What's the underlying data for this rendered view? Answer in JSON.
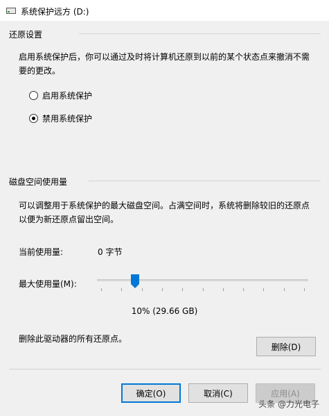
{
  "window": {
    "title": "系统保护远方 (D:)"
  },
  "restore_section": {
    "title": "还原设置",
    "description_line1": "启用系统保护后，你可以通过及时将计算机还原到以前的某个状态点来撤消不需",
    "description_line2": "要的更改。",
    "options": [
      {
        "label": "启用系统保护",
        "selected": false
      },
      {
        "label": "禁用系统保护",
        "selected": true
      }
    ]
  },
  "disk_section": {
    "title": "磁盘空间使用量",
    "description_line1": "可以调整用于系统保护的最大磁盘空间。占满空间时，系统将删除较旧的还原点",
    "description_line2": "以便为新还原点留出空间。",
    "current_usage_label": "当前使用量:",
    "current_usage_value": "0 字节",
    "max_usage_label": "最大使用量(M):",
    "slider_fraction": 0.1,
    "max_usage_value": "10% (29.66 GB)",
    "delete_description": "删除此驱动器的所有还原点。",
    "delete_button": "删除(D)"
  },
  "footer": {
    "ok_button": "确定(O)",
    "cancel_button": "取消(C)",
    "apply_button": "应用(A)"
  },
  "watermark": {
    "text": "头条 @力光电子"
  }
}
